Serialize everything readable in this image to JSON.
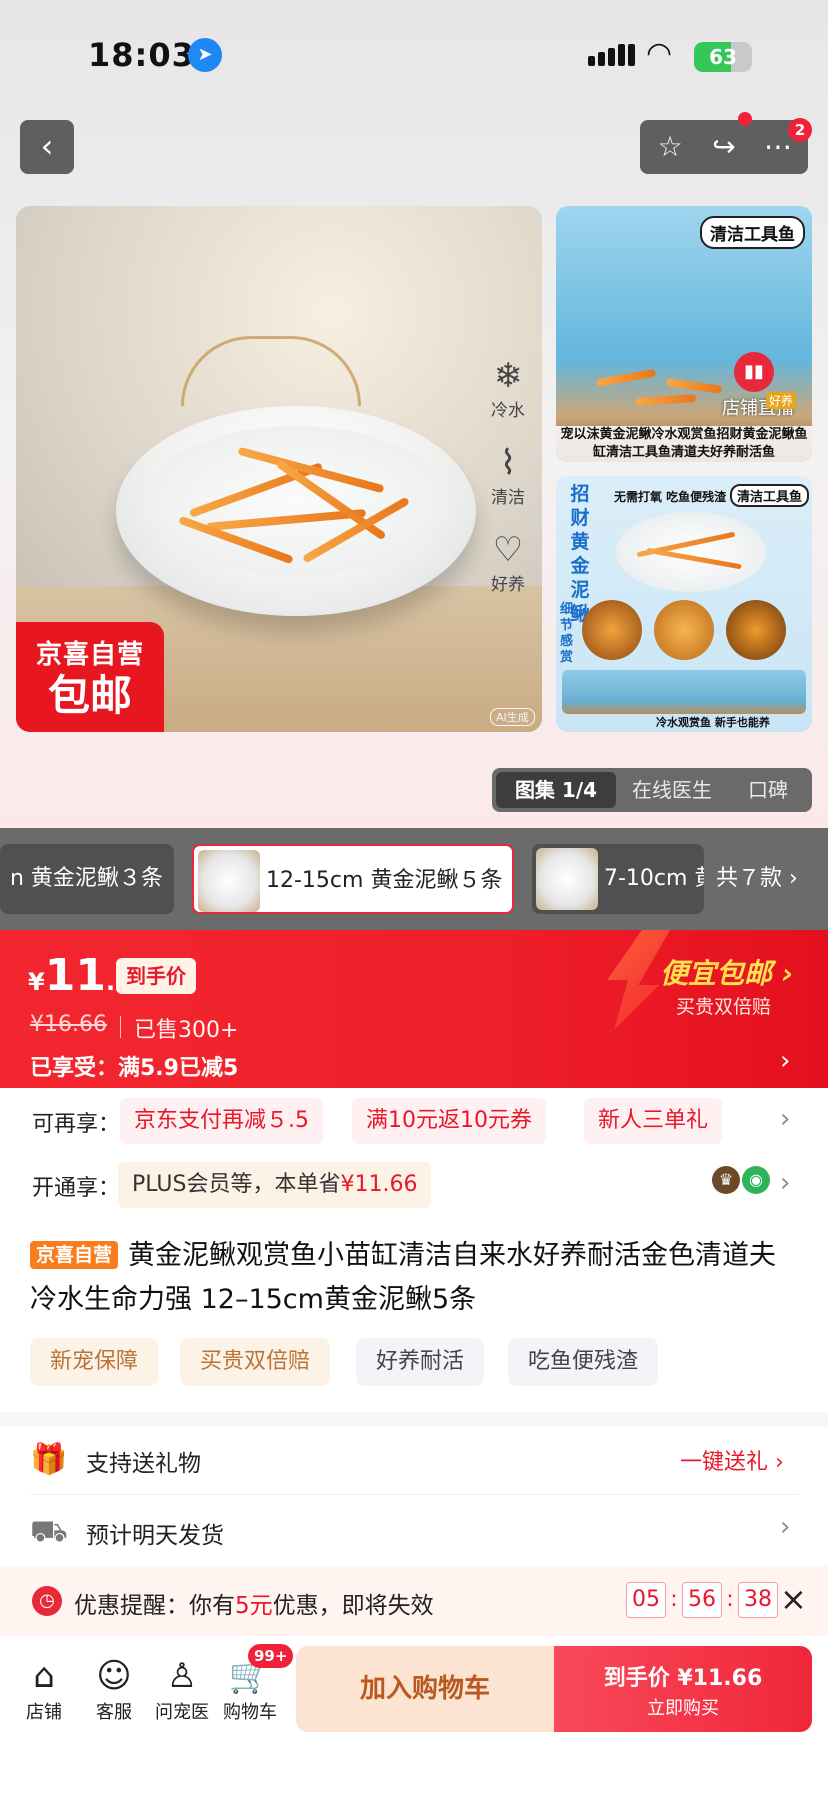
{
  "status_bar": {
    "time": "18:03",
    "battery": "63",
    "battery_level": 0.63
  },
  "header": {
    "back_icon": "chevron-left-icon",
    "more_badge": "2"
  },
  "gallery": {
    "main_badge_line1": "京喜自营",
    "main_badge_line2": "包邮",
    "side_icons": [
      {
        "icon": "thermometer-icon",
        "label": "冷水"
      },
      {
        "icon": "broom-icon",
        "label": "清洁"
      },
      {
        "icon": "fish-bowl-icon",
        "label": "好养"
      }
    ],
    "ai_tag": "AI生成",
    "thumb1_bubble": "清洁工具鱼",
    "thumb1_caption": "宠以沫黄金泥鳅冷水观赏鱼招财黄金泥鳅鱼缸清洁工具鱼清道夫好养耐活鱼",
    "live_label": "店铺直播",
    "live_tag": "好养",
    "thumb2_bubble": "清洁工具鱼",
    "thumb2_top_text": "无需打氧 吃鱼便残渣",
    "thumb2_side_text": "招财黄金泥鳅",
    "thumb2_detail_text": "细节感赏",
    "thumb2_bottom_text": "冷水观赏鱼 新手也能养",
    "tabs": [
      "图集 1/4",
      "在线医生",
      "口碑"
    ]
  },
  "variants": {
    "items": [
      {
        "label": "n 黄金泥鳅３条"
      },
      {
        "label": "12-15cm 黄金泥鳅５条"
      },
      {
        "label": "7-10cm 黄"
      }
    ],
    "total": "共７款 ›"
  },
  "price": {
    "currency": "¥",
    "integer": "11",
    "decimal": ".66",
    "to_hand_label": "到手价",
    "original": "¥16.66",
    "sold": "已售300+",
    "enjoyed": "已享受：满5.9已减5",
    "promo_title": "便宜包邮 ›",
    "promo_sub": "买贵双倍赔"
  },
  "offers": {
    "label": "可再享：",
    "coupons": [
      "京东支付再减５.5",
      "满10元返10元券",
      "新人三单礼"
    ]
  },
  "plus": {
    "label": "开通享：",
    "text": "PLUS会员等，本单省",
    "amount": "¥11.66"
  },
  "product": {
    "store_tag": "京喜自营",
    "title": "黄金泥鳅观赏鱼小苗缸清洁自来水好养耐活金色清道夫冷水生命力强 12–15cm黄金泥鳅5条",
    "tags": [
      "新宠保障",
      "买贵双倍赔",
      "好养耐活",
      "吃鱼便残渣"
    ]
  },
  "services": [
    {
      "icon": "gift-icon",
      "text": "支持送礼物",
      "right": "一键送礼 ›"
    },
    {
      "icon": "truck-icon",
      "text": "预计明天发货",
      "right": ""
    }
  ],
  "reminder": {
    "prefix": "优惠提醒：你有",
    "highlight": "5元",
    "suffix": "优惠，即将失效",
    "hours": "05",
    "minutes": "56",
    "seconds": "38"
  },
  "bottom_bar": {
    "nav": [
      {
        "icon": "store-icon",
        "label": "店铺"
      },
      {
        "icon": "chat-icon",
        "label": "客服"
      },
      {
        "icon": "doctor-icon",
        "label": "问宠医"
      },
      {
        "icon": "cart-icon",
        "label": "购物车"
      }
    ],
    "cart_badge": "99+",
    "add_to_cart": "加入购物车",
    "buy_price": "到手价 ¥11.66",
    "buy_now": "立即购买"
  },
  "colors": {
    "accent_red": "#F2263A",
    "orange": "#F97D1C",
    "price_red": "#E8172A"
  }
}
